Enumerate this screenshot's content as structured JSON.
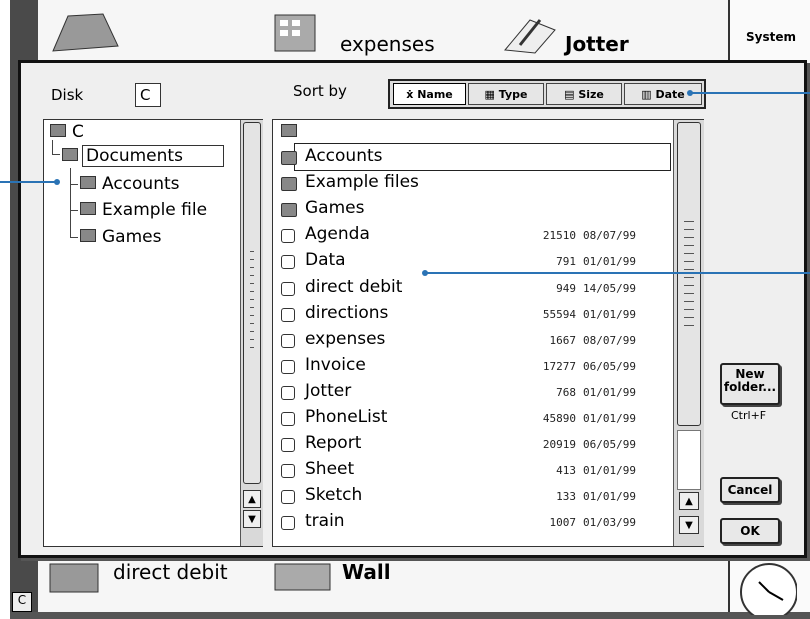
{
  "desktop": {
    "icons_top": [
      "expenses",
      "Jotter"
    ],
    "icons_bottom": [
      "direct debit",
      "Wall"
    ],
    "right_panel_title": "System"
  },
  "dialog": {
    "disk_label": "Disk",
    "disk_value": "C",
    "sort_label": "Sort by",
    "sort_options": [
      {
        "label": "Name",
        "icon": "abc-icon",
        "selected": true
      },
      {
        "label": "Type",
        "icon": "type-icon",
        "selected": false
      },
      {
        "label": "Size",
        "icon": "size-icon",
        "selected": false
      },
      {
        "label": "Date",
        "icon": "calendar-icon",
        "selected": false
      }
    ],
    "tree": {
      "root": "C",
      "folder": "Documents",
      "children": [
        "Accounts",
        "Example file",
        "Games"
      ]
    },
    "files": [
      {
        "name": "Accounts",
        "type": "folder",
        "size": "",
        "date": ""
      },
      {
        "name": "Example files",
        "type": "folder",
        "size": "",
        "date": ""
      },
      {
        "name": "Games",
        "type": "folder",
        "size": "",
        "date": ""
      },
      {
        "name": "Agenda",
        "type": "file",
        "size": "21510",
        "date": "08/07/99"
      },
      {
        "name": "Data",
        "type": "file",
        "size": "791",
        "date": "01/01/99"
      },
      {
        "name": "direct debit",
        "type": "file",
        "size": "949",
        "date": "14/05/99"
      },
      {
        "name": "directions",
        "type": "file",
        "size": "55594",
        "date": "01/01/99"
      },
      {
        "name": "expenses",
        "type": "file",
        "size": "1667",
        "date": "08/07/99"
      },
      {
        "name": "Invoice",
        "type": "file",
        "size": "17277",
        "date": "06/05/99"
      },
      {
        "name": "Jotter",
        "type": "file",
        "size": "768",
        "date": "01/01/99"
      },
      {
        "name": "PhoneList",
        "type": "file",
        "size": "45890",
        "date": "01/01/99"
      },
      {
        "name": "Report",
        "type": "file",
        "size": "20919",
        "date": "06/05/99"
      },
      {
        "name": "Sheet",
        "type": "file",
        "size": "413",
        "date": "01/01/99"
      },
      {
        "name": "Sketch",
        "type": "file",
        "size": "133",
        "date": "01/01/99"
      },
      {
        "name": "train",
        "type": "file",
        "size": "1007",
        "date": "01/03/99"
      }
    ],
    "new_folder_label_line1": "New",
    "new_folder_label_line2": "folder...",
    "new_folder_shortcut": "Ctrl+F",
    "cancel_label": "Cancel",
    "ok_label": "OK"
  },
  "colors": {
    "callout": "#2a73b5"
  }
}
